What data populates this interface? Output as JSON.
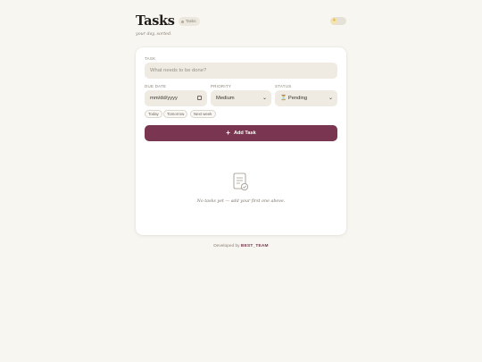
{
  "header": {
    "title": "Tasks .",
    "badge": "Tasks",
    "subtitle": "your day, sorted.",
    "theme_toggle_icon": "sun-icon"
  },
  "form": {
    "task_label": "TASK",
    "task_placeholder": "What needs to be done?",
    "due_label": "DUE DATE",
    "due_value": "mm/dd/yyyy",
    "priority_label": "PRIORITY",
    "priority_value": "Medium",
    "status_label": "STATUS",
    "status_value": "⏳ Pending",
    "chips": [
      "Today",
      "Tomorrow",
      "Next week"
    ],
    "add_label": "Add Task"
  },
  "empty_state": {
    "icon": "clipboard-check-icon",
    "message": "No tasks yet — add your first one above."
  },
  "footer": {
    "prefix": "Developed by",
    "team": "BEST_TEAM"
  },
  "colors": {
    "accent": "#7a3650",
    "background": "#f8f6f1",
    "field": "#efebe3"
  }
}
